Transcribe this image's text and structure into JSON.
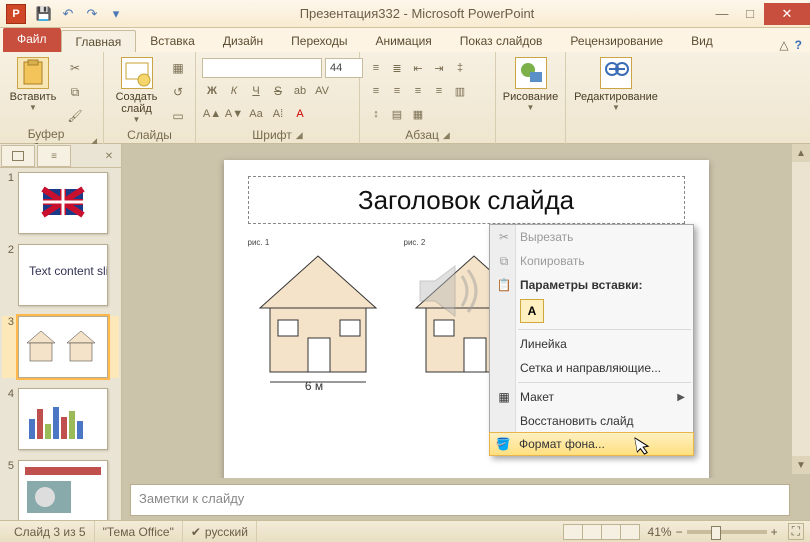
{
  "window": {
    "title": "Презентация332 - Microsoft PowerPoint",
    "app_letter": "P"
  },
  "tabs": {
    "file": "Файл",
    "items": [
      "Главная",
      "Вставка",
      "Дизайн",
      "Переходы",
      "Анимация",
      "Показ слайдов",
      "Рецензирование",
      "Вид"
    ],
    "active_index": 0
  },
  "ribbon": {
    "clipboard": {
      "paste": "Вставить",
      "label": "Буфер обмена"
    },
    "slides": {
      "new_slide": "Создать\nслайд",
      "label": "Слайды"
    },
    "font": {
      "size": "44",
      "label": "Шрифт"
    },
    "paragraph": {
      "label": "Абзац"
    },
    "drawing": {
      "btn": "Рисование",
      "label": ""
    },
    "editing": {
      "btn": "Редактирование",
      "label": ""
    }
  },
  "thumbnails": {
    "count": 5,
    "selected": 3
  },
  "slide": {
    "title_placeholder": "Заголовок слайда",
    "caption_left": "рис. 1",
    "caption_right": "рис. 2",
    "dim_label": "6 м"
  },
  "notes": {
    "placeholder": "Заметки к слайду"
  },
  "context_menu": {
    "cut": "Вырезать",
    "copy": "Копировать",
    "paste_options_header": "Параметры вставки:",
    "paste_opt_letter": "А",
    "ruler": "Линейка",
    "grid": "Сетка и направляющие...",
    "layout": "Макет",
    "reset": "Восстановить слайд",
    "format_bg": "Формат фона..."
  },
  "status": {
    "slide_info": "Слайд 3 из 5",
    "theme": "\"Тема Office\"",
    "language": "русский",
    "zoom": "41%"
  }
}
